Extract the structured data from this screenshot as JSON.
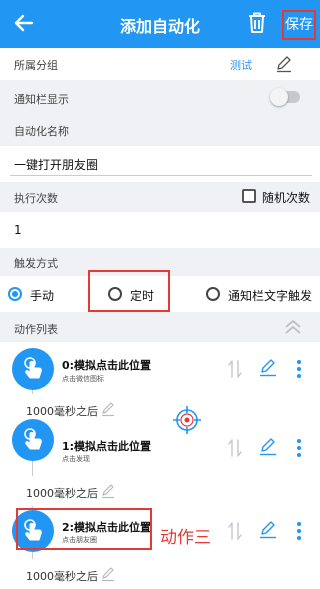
{
  "header": {
    "title": "添加自动化",
    "save_label": "保存",
    "back_icon": "arrow-left-icon",
    "delete_icon": "trash-icon"
  },
  "group": {
    "label": "所属分组",
    "value": "测试"
  },
  "notification": {
    "label": "通知栏显示",
    "enabled": false
  },
  "name": {
    "label": "自动化名称",
    "value": "一键打开朋友圈"
  },
  "exec_count": {
    "label": "执行次数",
    "random_label": "随机次数",
    "random_checked": false,
    "value": "1"
  },
  "trigger": {
    "label": "触发方式",
    "options": [
      "手动",
      "定时",
      "通知栏文字触发"
    ],
    "selected": "手动"
  },
  "actions": {
    "label": "动作列表",
    "items": [
      {
        "title": "0:模拟点击此位置",
        "subtitle": "点击微信图标",
        "delay": "1000毫秒之后"
      },
      {
        "title": "1:模拟点击此位置",
        "subtitle": "点击发现",
        "delay": "1000毫秒之后"
      },
      {
        "title": "2:模拟点击此位置",
        "subtitle": "点击朋友圈",
        "delay": "1000毫秒之后"
      }
    ]
  },
  "annotation": {
    "text": "动作三"
  },
  "colors": {
    "accent": "#2196f3",
    "highlight": "#e53935",
    "background": "#f0f1f4"
  }
}
